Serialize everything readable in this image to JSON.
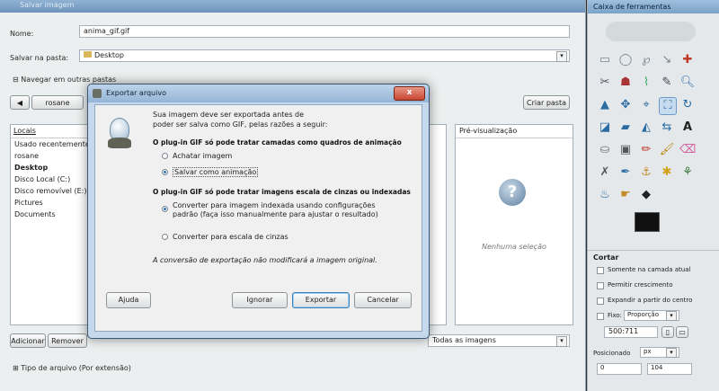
{
  "save_dialog": {
    "title": "Salvar imagem",
    "name_label": "Nome:",
    "name_value": "anima_gif.gif",
    "folder_label": "Salvar na pasta:",
    "folder_value": "Desktop",
    "browse_label": "Navegar em outras pastas",
    "breadcrumb_user": "rosane",
    "create_folder_label": "Criar pasta",
    "places_header": "Locais",
    "places": [
      "Usado recentemente",
      "rosane",
      "Desktop",
      "Disco Local (C:)",
      "Disco removível (E:)",
      "Pictures",
      "Documents"
    ],
    "preview_header": "Pré-visualização",
    "preview_no_selection": "Nenhuma seleção",
    "add_button": "Adicionar",
    "remove_button": "Remover",
    "filter_label": "Todas as imagens",
    "file_type_label": "Tipo de arquivo (Por extensão)"
  },
  "export_dialog": {
    "title": "Exportar arquivo",
    "intro_line1": "Sua imagem deve ser exportada antes de",
    "intro_line2": "poder ser salva como GIF, pelas razões a seguir:",
    "section1": "O plug-in GIF só pode tratar camadas como quadros de animação",
    "option_flatten": "Achatar imagem",
    "option_animation": "Salvar como animação",
    "section2": "O plug-in GIF só pode tratar imagens escala de cinzas ou indexadas",
    "option_indexed_line1": "Converter para imagem indexada usando configurações",
    "option_indexed_line2": "padrão (faça isso manualmente para ajustar o resultado)",
    "option_grayscale": "Converter para escala de cinzas",
    "footer_note": "A conversão de exportação não modificará a imagem original.",
    "help_button": "Ajuda",
    "ignore_button": "Ignorar",
    "export_button": "Exportar",
    "cancel_button": "Cancelar",
    "close_glyph": "x"
  },
  "toolbox": {
    "title": "Caixa de ferramentas",
    "tool_options_title": "Cortar",
    "opt_current_layer": "Somente na camada atual",
    "opt_allow_growing": "Permitir crescimento",
    "opt_expand_center": "Expandir a partir do centro",
    "opt_fixed": "Fixo:",
    "opt_fixed_value": "Proporção",
    "ratio_value": "500:711",
    "position_label": "Posicionado",
    "position_unit": "px",
    "pos_x": "0",
    "pos_y": "104"
  },
  "colors": {
    "titlebar": "#7aa2c8",
    "close_red": "#c8452f",
    "dialog_bg": "#f0f0f0"
  }
}
